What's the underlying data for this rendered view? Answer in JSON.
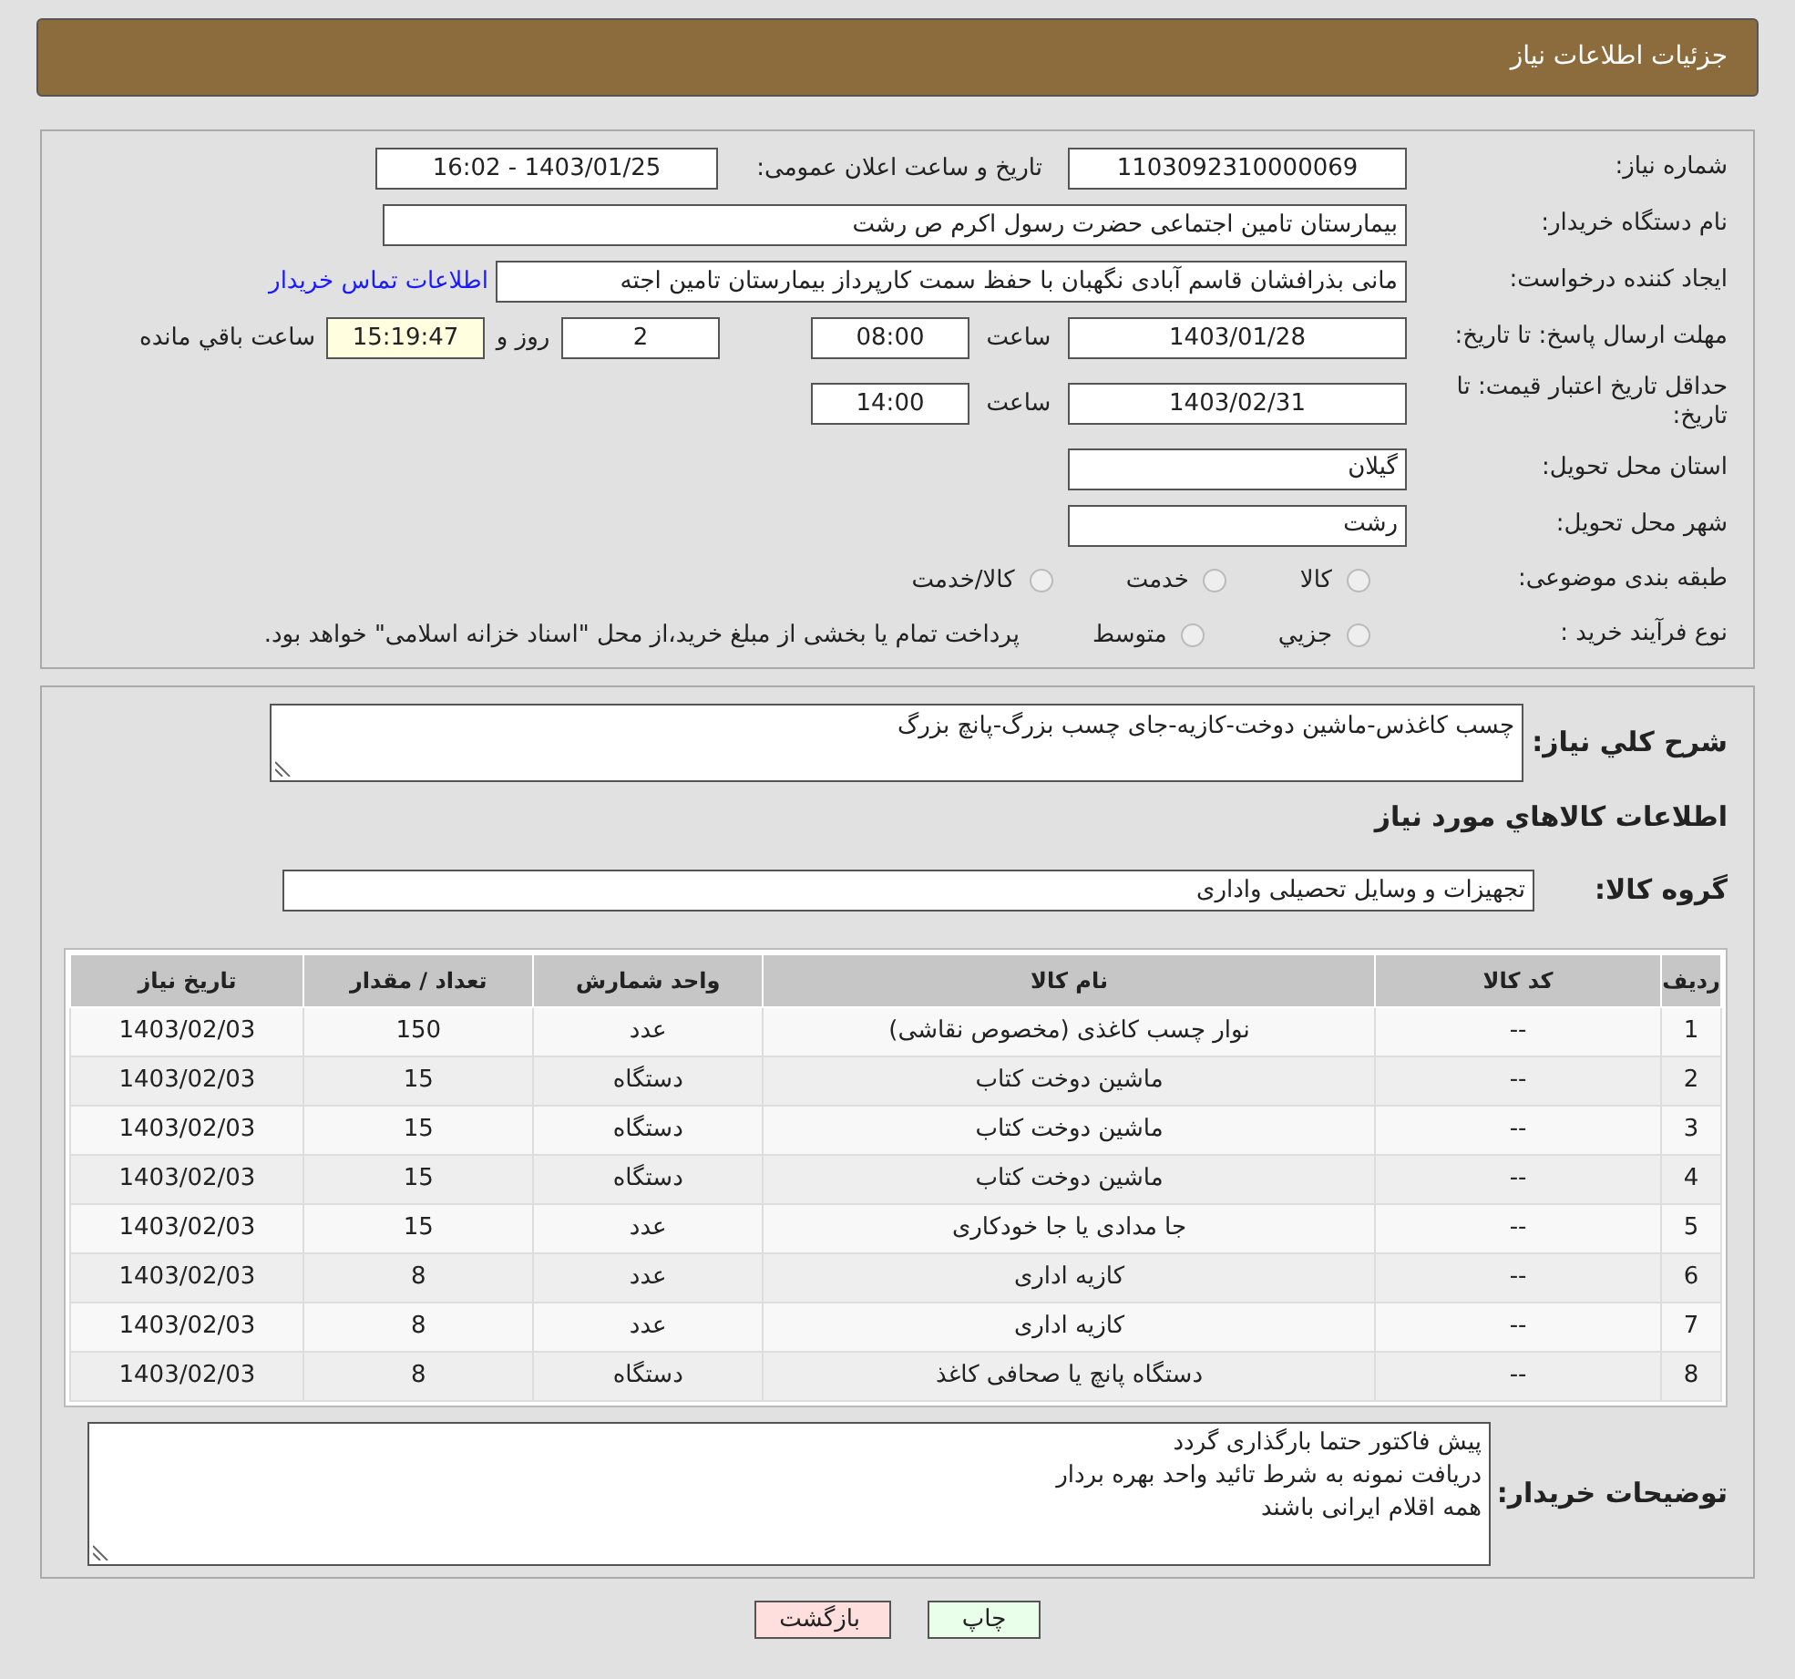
{
  "header": {
    "title": "جزئیات اطلاعات نیاز"
  },
  "details": {
    "need_number": {
      "label": "شماره نیاز:",
      "value": "1103092310000069"
    },
    "announce": {
      "label": "تاریخ و ساعت اعلان عمومی:",
      "value": "1403/01/25 - 16:02"
    },
    "buyer": {
      "label": "نام دستگاه خریدار:",
      "value": "بیمارستان  تامین اجتماعی حضرت رسول اکرم ص رشت"
    },
    "creator": {
      "label": "ایجاد کننده درخواست:",
      "value": "مانی بذرافشان قاسم آبادی نگهبان با حفظ سمت کارپرداز بیمارستان  تامین اجته",
      "link": "اطلاعات تماس خریدار"
    },
    "reply_deadline": {
      "label": "مهلت ارسال پاسخ: تا تاریخ:",
      "date": "1403/01/28",
      "time_label": "ساعت",
      "time": "08:00",
      "days": "2",
      "days_label": "روز و",
      "remaining": "15:19:47",
      "remaining_label": "ساعت باقي مانده"
    },
    "price_validity": {
      "label": "حداقل تاریخ اعتبار قیمت: تا تاریخ:",
      "date": "1403/02/31",
      "time_label": "ساعت",
      "time": "14:00"
    },
    "province": {
      "label": "استان محل تحویل:",
      "value": "گیلان"
    },
    "city": {
      "label": "شهر محل تحویل:",
      "value": "رشت"
    },
    "category": {
      "label": "طبقه بندی موضوعی:",
      "options": [
        {
          "label": "کالا",
          "selected": false
        },
        {
          "label": "خدمت",
          "selected": false
        },
        {
          "label": "کالا/خدمت",
          "selected": false
        }
      ]
    },
    "process": {
      "label": "نوع فرآیند خرید :",
      "options": [
        {
          "label": "جزيي",
          "selected": false
        },
        {
          "label": "متوسط",
          "selected": false
        }
      ],
      "note": "پرداخت تمام یا بخشی از مبلغ خرید،از محل \"اسناد خزانه اسلامی\" خواهد بود."
    }
  },
  "needs": {
    "summary_label": "شرح كلي نياز:",
    "summary": "چسب کاغذس-ماشین دوخت-کازیه-جای چسب بزرگ-پانچ بزرگ",
    "goods_heading": "اطلاعات كالاهاي مورد نياز",
    "group_label": "گروه کالا:",
    "group": "تجهیزات و وسایل تحصیلی واداری"
  },
  "table": {
    "columns": [
      "ردیف",
      "کد کالا",
      "نام کالا",
      "واحد شمارش",
      "تعداد / مقدار",
      "تاریخ نیاز"
    ],
    "rows": [
      [
        "1",
        "--",
        "نوار چسب کاغذی (مخصوص نقاشی)",
        "عدد",
        "150",
        "1403/02/03"
      ],
      [
        "2",
        "--",
        "ماشین دوخت کتاب",
        "دستگاه",
        "15",
        "1403/02/03"
      ],
      [
        "3",
        "--",
        "ماشین دوخت کتاب",
        "دستگاه",
        "15",
        "1403/02/03"
      ],
      [
        "4",
        "--",
        "ماشین دوخت کتاب",
        "دستگاه",
        "15",
        "1403/02/03"
      ],
      [
        "5",
        "--",
        "جا مدادی یا جا خودکاری",
        "عدد",
        "15",
        "1403/02/03"
      ],
      [
        "6",
        "--",
        "کازیه اداری",
        "عدد",
        "8",
        "1403/02/03"
      ],
      [
        "7",
        "--",
        "کازیه اداری",
        "عدد",
        "8",
        "1403/02/03"
      ],
      [
        "8",
        "--",
        "دستگاه پانچ یا صحافی کاغذ",
        "دستگاه",
        "8",
        "1403/02/03"
      ]
    ]
  },
  "buyer_notes": {
    "label": "توضیحات خریدار:",
    "lines": [
      "پیش فاکتور حتما بارگذاری گردد",
      "دریافت نمونه به شرط تائید واحد بهره بردار",
      "همه اقلام ایرانی باشند"
    ]
  },
  "buttons": [
    {
      "kind": "print",
      "label": "چاپ"
    },
    {
      "kind": "back",
      "label": "بازگشت"
    }
  ]
}
